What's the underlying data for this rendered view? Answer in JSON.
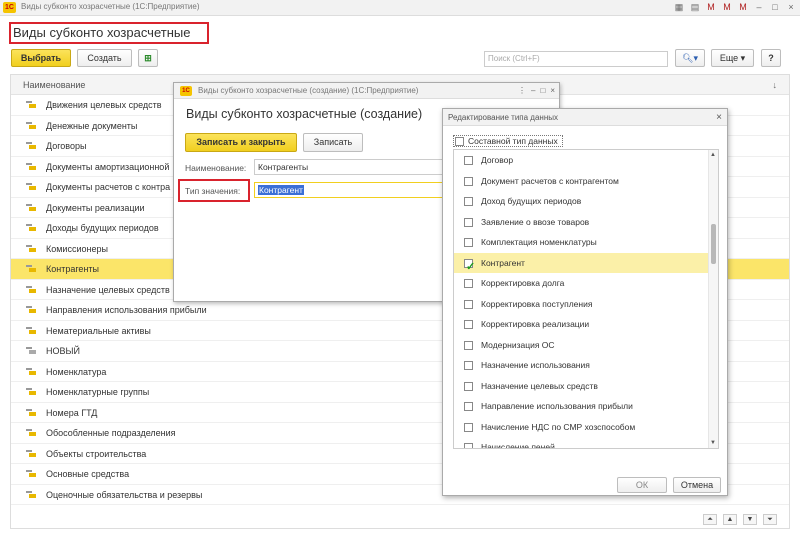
{
  "window": {
    "app_logo": "1С",
    "title": "Виды субконто хозрасчетные (1С:Предприятие)"
  },
  "page": {
    "title": "Виды субконто хозрасчетные"
  },
  "toolbar": {
    "select_label": "Выбрать",
    "create_label": "Создать",
    "search_placeholder": "Поиск (Ctrl+F)",
    "more_label": "Еще",
    "help_label": "?"
  },
  "list": {
    "column_header": "Наименование",
    "rows": [
      {
        "label": "Движения целевых средств"
      },
      {
        "label": "Денежные документы"
      },
      {
        "label": "Договоры"
      },
      {
        "label": "Документы амортизационной"
      },
      {
        "label": "Документы расчетов с контра"
      },
      {
        "label": "Документы реализации"
      },
      {
        "label": "Доходы будущих периодов"
      },
      {
        "label": "Комиссионеры"
      },
      {
        "label": "Контрагенты"
      },
      {
        "label": "Назначение целевых средств"
      },
      {
        "label": "Направления использования прибыли"
      },
      {
        "label": "Нематериальные активы"
      },
      {
        "label": "НОВЫЙ"
      },
      {
        "label": "Номенклатура"
      },
      {
        "label": "Номенклатурные группы"
      },
      {
        "label": "Номера ГТД"
      },
      {
        "label": "Обособленные подразделения"
      },
      {
        "label": "Объекты строительства"
      },
      {
        "label": "Основные средства"
      },
      {
        "label": "Оценочные обязательства и резервы"
      }
    ]
  },
  "create_dialog": {
    "window_title": "Виды субконто хозрасчетные (создание) (1С:Предприятие)",
    "heading": "Виды субконто хозрасчетные (создание)",
    "save_close_label": "Записать и закрыть",
    "save_label": "Записать",
    "name_label": "Наименование:",
    "name_value": "Контрагенты",
    "type_label": "Тип значения:",
    "type_value": "Контрагент"
  },
  "type_dialog": {
    "title": "Редактирование типа данных",
    "composite_label": "Составной тип данных",
    "items": [
      {
        "label": "Договор",
        "checked": false
      },
      {
        "label": "Документ расчетов с контрагентом",
        "checked": false
      },
      {
        "label": "Доход будущих периодов",
        "checked": false
      },
      {
        "label": "Заявление о ввозе товаров",
        "checked": false
      },
      {
        "label": "Комплектация номенклатуры",
        "checked": false
      },
      {
        "label": "Контрагент",
        "checked": true
      },
      {
        "label": "Корректировка долга",
        "checked": false
      },
      {
        "label": "Корректировка поступления",
        "checked": false
      },
      {
        "label": "Корректировка реализации",
        "checked": false
      },
      {
        "label": "Модернизация ОС",
        "checked": false
      },
      {
        "label": "Назначение использования",
        "checked": false
      },
      {
        "label": "Назначение целевых средств",
        "checked": false
      },
      {
        "label": "Направление использования прибыли",
        "checked": false
      },
      {
        "label": "Начисление НДС по СМР хозспособом",
        "checked": false
      },
      {
        "label": "Начисление пеней",
        "checked": false
      }
    ],
    "ok_label": "ОК",
    "cancel_label": "Отмена"
  },
  "colors": {
    "accent_yellow": "#f1cf1f",
    "selection_yellow": "#fbe569",
    "highlight_red": "#d9232d",
    "check_green": "#1a9a1a"
  }
}
